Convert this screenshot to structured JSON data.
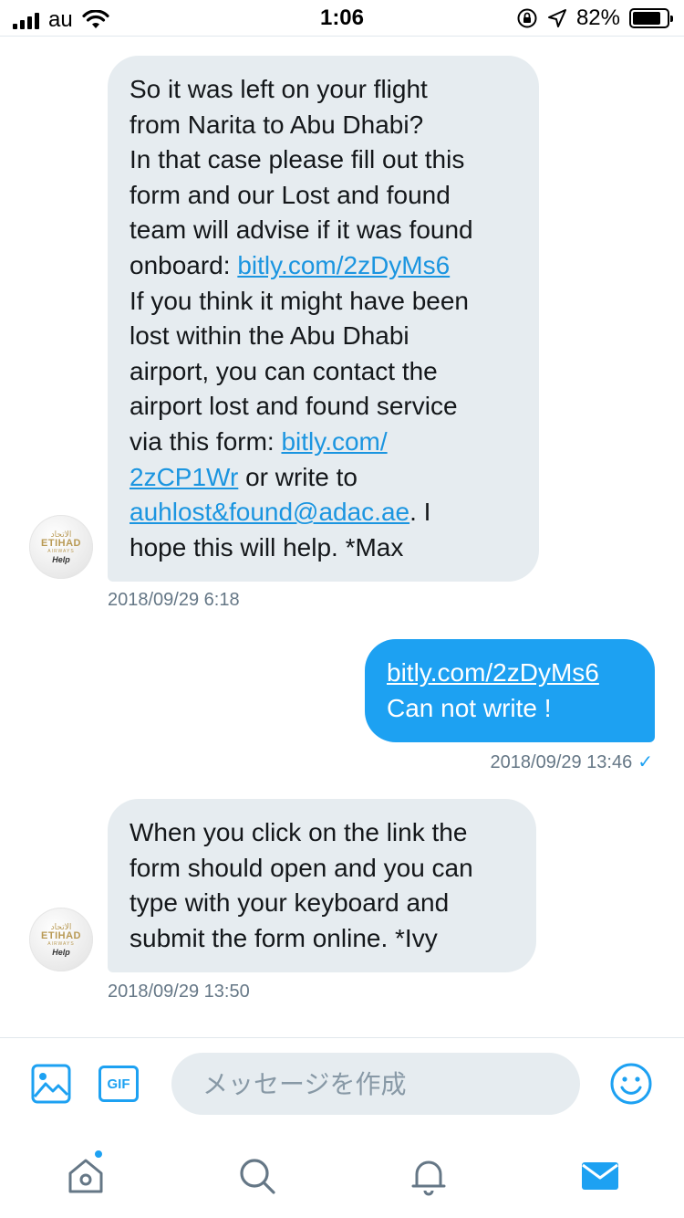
{
  "status_bar": {
    "carrier": "au",
    "time": "1:06",
    "battery_percent": "82%",
    "battery_level": 0.82
  },
  "conversation": {
    "messages": [
      {
        "direction": "incoming",
        "lines": [
          "So it was left on your flight",
          "from Narita to Abu Dhabi?",
          "In that case please fill out this",
          "form and our Lost and found",
          "team will advise if it was found",
          "onboard: ",
          "bitly.com/2zDyMs6",
          "If you think it might have been",
          "lost within the Abu Dhabi",
          "airport, you can contact the",
          "airport lost and found service",
          "via this form: ",
          "bitly.com/",
          "2zCP1Wr",
          " or write to",
          "auhlost&found@adac.ae",
          ".  I",
          "hope this will help. *Max"
        ],
        "timestamp": "2018/09/29 6:18"
      },
      {
        "direction": "outgoing",
        "lines": [
          "bitly.com/2zDyMs6",
          "Can not write !"
        ],
        "timestamp": "2018/09/29 13:46",
        "read_mark": "✓"
      },
      {
        "direction": "incoming",
        "lines": [
          "When you click on the link the",
          "form should open and you can",
          "type with your keyboard and",
          "submit the form online. *Ivy"
        ],
        "timestamp": "2018/09/29 13:50"
      }
    ],
    "avatar": {
      "arabic": "الاتحاد",
      "brand": "ETIHAD",
      "sub": "AIRWAYS",
      "help": "Help"
    }
  },
  "composer": {
    "gif_label": "GIF",
    "placeholder": "メッセージを作成"
  },
  "colors": {
    "accent": "#1da1f2",
    "bubble_incoming": "#e6ecf0",
    "link": "#1b95e0",
    "timestamp": "#657786"
  },
  "tab_bar": {
    "tabs": [
      "home-icon",
      "search-icon",
      "bell-icon",
      "mail-icon"
    ]
  }
}
